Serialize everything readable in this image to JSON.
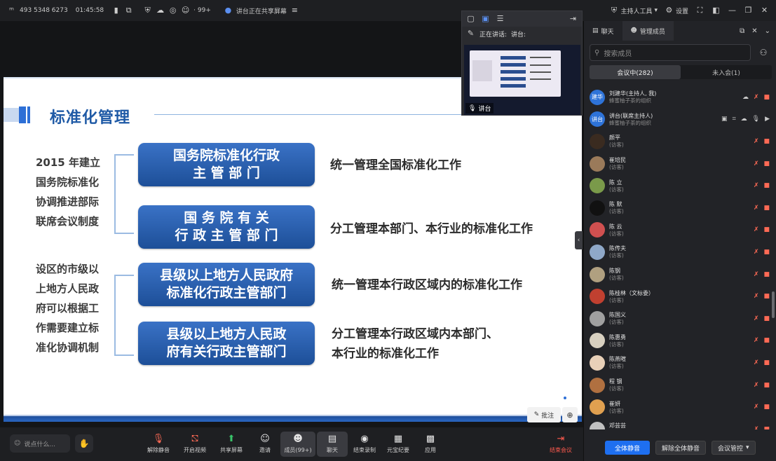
{
  "topbar": {
    "meeting_id": "493 5348 6273",
    "time": "01:45:58",
    "participants_badge": "99+",
    "sharing_status": "讲台正在共享屏幕"
  },
  "topright": {
    "host_label": "主持人工具",
    "settings_label": "设置"
  },
  "speaker_window": {
    "now_speaking_label": "正在讲话:",
    "now_speaking_name": "讲台:",
    "video_label": "讲台"
  },
  "slide": {
    "title": "标准化管理",
    "left_text_1": [
      "2015 年建立",
      "国务院标准化",
      "协调推进部际",
      "联席会议制度"
    ],
    "left_text_2": [
      "设区的市级以",
      "上地方人民政",
      "府可以根据工",
      "作需要建立标",
      "准化协调机制"
    ],
    "boxes": [
      {
        "line1": "国务院标准化行政",
        "line2": "主  管  部  门",
        "desc1": "统一管理全国标准化工作",
        "desc2": ""
      },
      {
        "line1": "国 务 院 有 关",
        "line2": "行 政 主 管 部 门",
        "desc1": "分工管理本部门、本行业的标准化工作",
        "desc2": ""
      },
      {
        "line1": "县级以上地方人民政府",
        "line2": "标准化行政主管部门",
        "desc1": "统一管理本行政区域内的标准化工作",
        "desc2": ""
      },
      {
        "line1": "县级以上地方人民政",
        "line2": "府有关行政主管部门",
        "desc1": "分工管理本行政区域内本部门、",
        "desc2": "本行业的标准化工作"
      }
    ]
  },
  "annotate": {
    "label": "批注"
  },
  "bottombar": {
    "chat_placeholder": "说点什么...",
    "tools": [
      {
        "label": "解除静音",
        "icon": "mic-off-icon"
      },
      {
        "label": "开启视频",
        "icon": "camera-off-icon"
      },
      {
        "label": "共享屏幕",
        "icon": "share-screen-icon"
      },
      {
        "label": "邀请",
        "icon": "invite-icon"
      },
      {
        "label": "成员(99+)",
        "icon": "members-icon"
      },
      {
        "label": "聊天",
        "icon": "chat-icon"
      },
      {
        "label": "结束录制",
        "icon": "record-icon"
      },
      {
        "label": "元宝纪要",
        "icon": "notes-icon"
      },
      {
        "label": "应用",
        "icon": "apps-icon"
      },
      {
        "label": "结束会议",
        "icon": "end-meeting-icon"
      }
    ]
  },
  "panel": {
    "tab_chat": "聊天",
    "tab_members": "管理成员",
    "search_placeholder": "搜索成员",
    "in_meeting": "会议中(282)",
    "not_joined": "未入会(1)",
    "members": [
      {
        "name": "刘建华(主持人, 我)",
        "sub": "蜂蜜柚子茶的组织",
        "avatar_text": "建华",
        "color": "#2e73d8"
      },
      {
        "name": "讲台(联席主持人)",
        "sub": "蜂蜜柚子茶的组织",
        "avatar_text": "讲台",
        "color": "#2e73d8"
      },
      {
        "name": "颜平",
        "sub": "(访客)",
        "avatar_text": "",
        "color": "#3a2b20"
      },
      {
        "name": "崔培民",
        "sub": "(访客)",
        "avatar_text": "",
        "color": "#9a7a5a"
      },
      {
        "name": "陈 立",
        "sub": "(访客)",
        "avatar_text": "",
        "color": "#7a9a4a"
      },
      {
        "name": "陈 默",
        "sub": "(访客)",
        "avatar_text": "",
        "color": "#111111"
      },
      {
        "name": "陈 云",
        "sub": "(访客)",
        "avatar_text": "",
        "color": "#d05050"
      },
      {
        "name": "陈传夫",
        "sub": "(访客)",
        "avatar_text": "",
        "color": "#8fa8c8"
      },
      {
        "name": "陈钢",
        "sub": "(访客)",
        "avatar_text": "",
        "color": "#b0a080"
      },
      {
        "name": "陈桂林（文标委）",
        "sub": "(访客)",
        "avatar_text": "",
        "color": "#c04030"
      },
      {
        "name": "陈国义",
        "sub": "(访客)",
        "avatar_text": "",
        "color": "#a0a0a0"
      },
      {
        "name": "陈惠勇",
        "sub": "(访客)",
        "avatar_text": "",
        "color": "#d8d0c0"
      },
      {
        "name": "陈燕暄",
        "sub": "(访客)",
        "avatar_text": "",
        "color": "#e8d0b8"
      },
      {
        "name": "程 钢",
        "sub": "(访客)",
        "avatar_text": "",
        "color": "#b07040"
      },
      {
        "name": "崔妍",
        "sub": "(访客)",
        "avatar_text": "",
        "color": "#e0a050"
      },
      {
        "name": "邓芸芸",
        "sub": "(访客)",
        "avatar_text": "",
        "color": "#c0c0c0"
      }
    ],
    "mute_all": "全体静音",
    "unmute_all": "解除全体静音",
    "meeting_control": "会议管控"
  }
}
